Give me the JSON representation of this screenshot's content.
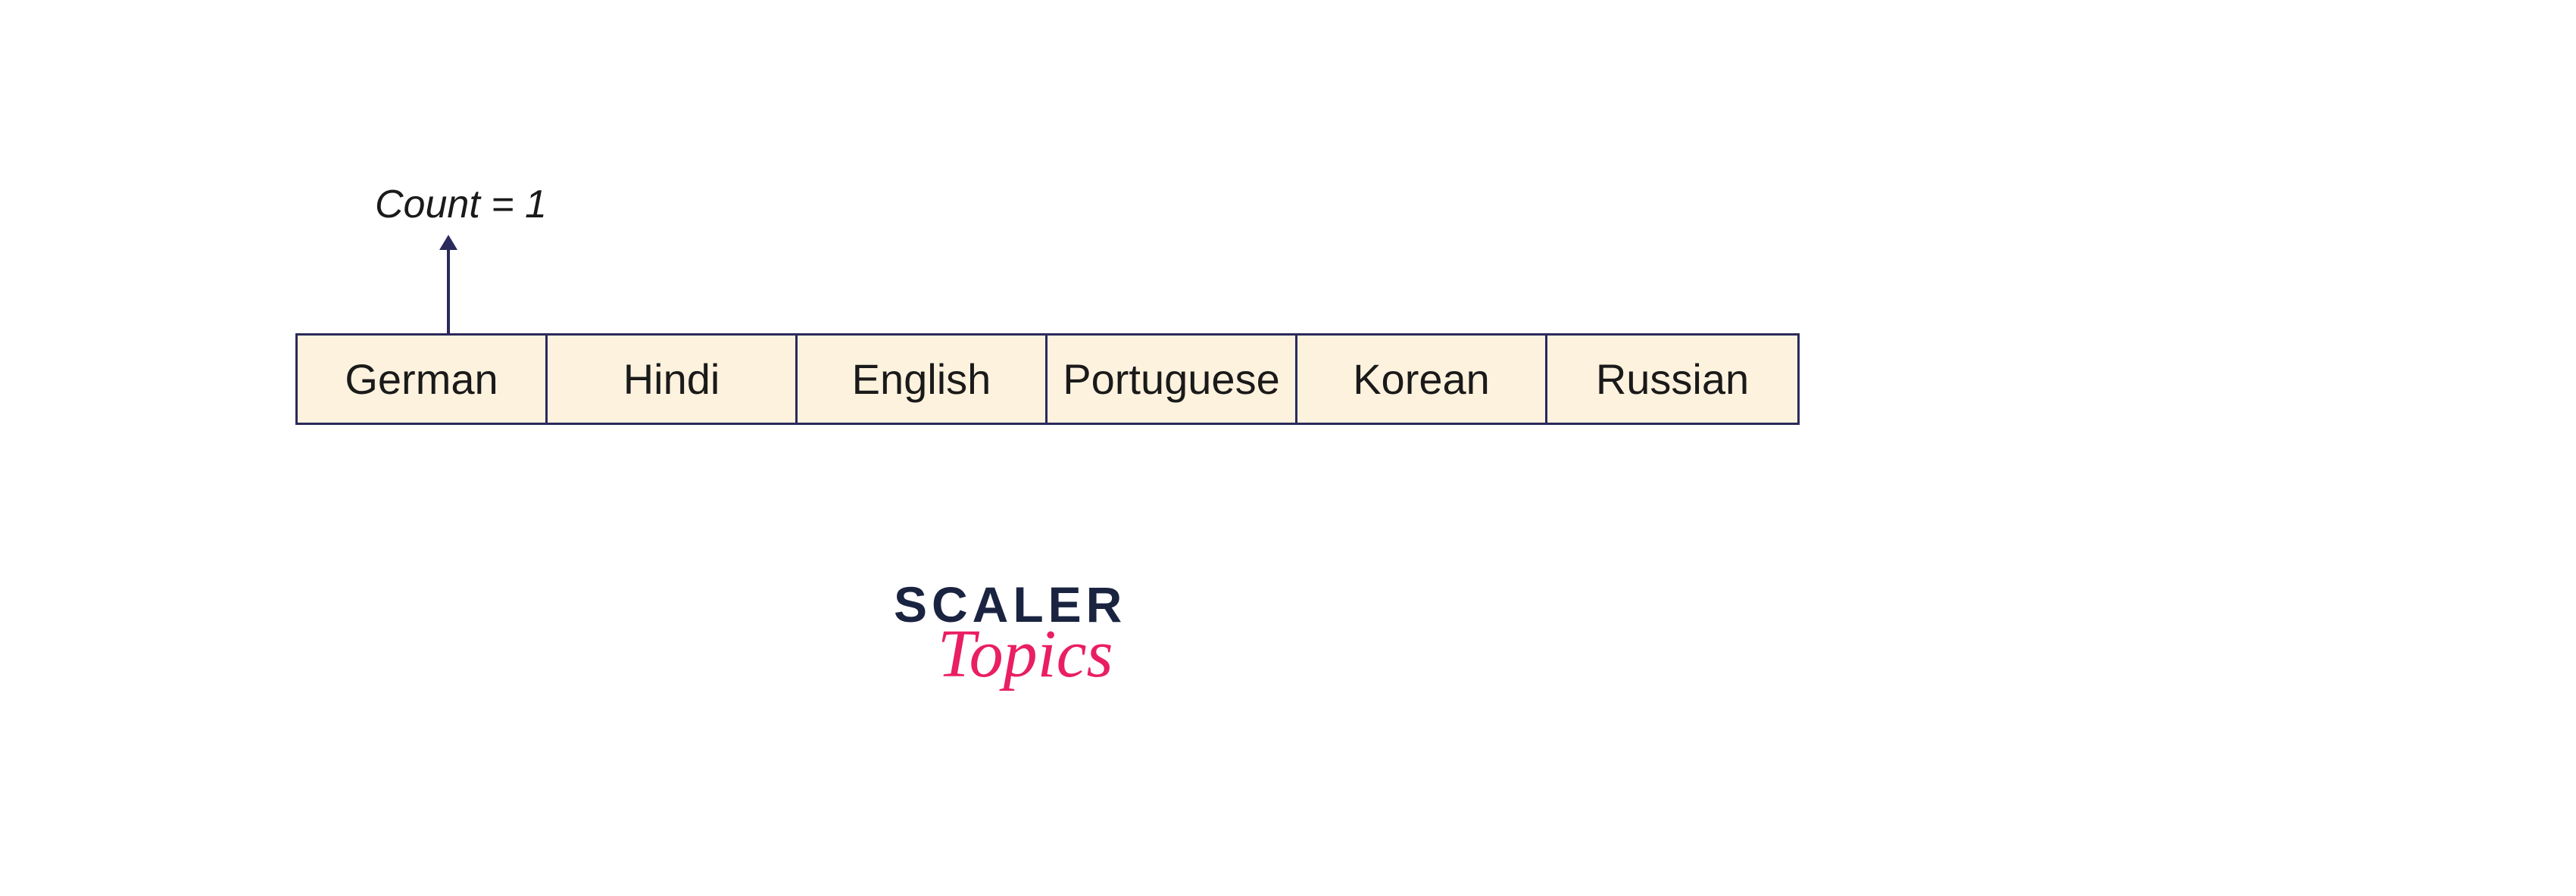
{
  "diagram": {
    "count_label": "Count = 1",
    "array_cells": [
      "German",
      "Hindi",
      "English",
      "Portuguese",
      "Korean",
      "Russian"
    ],
    "arrow_target_index": 0
  },
  "logo": {
    "line1": "SCALER",
    "line2": "Topics"
  }
}
